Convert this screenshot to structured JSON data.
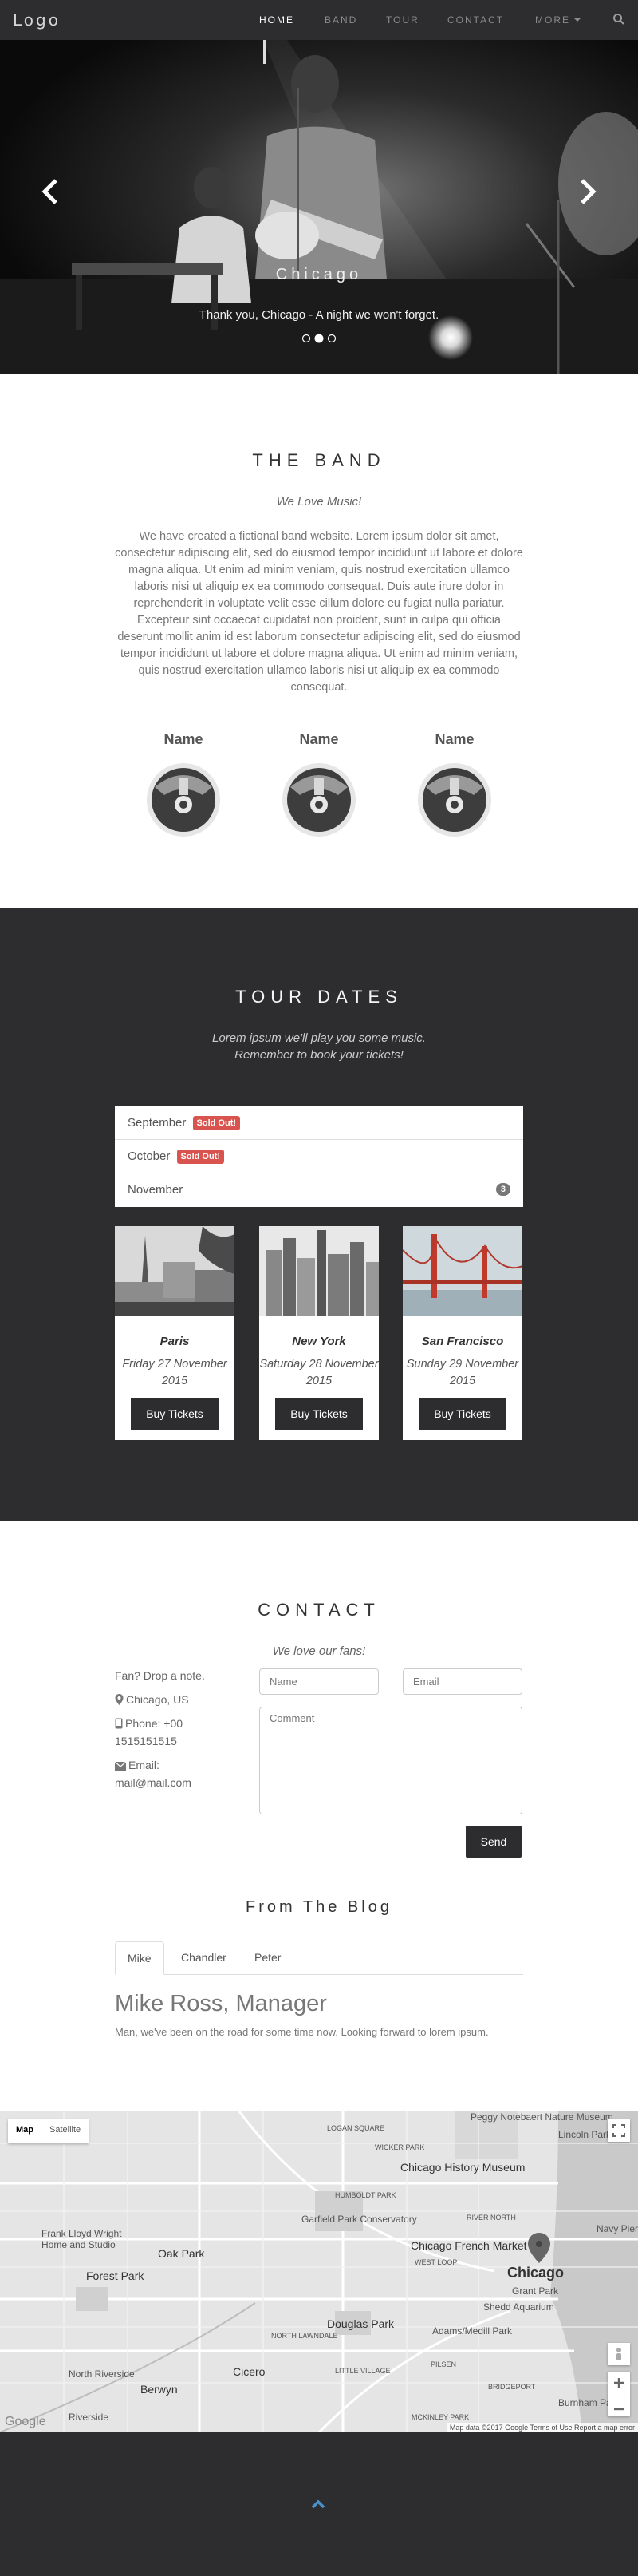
{
  "navbar": {
    "logo": "Logo",
    "items": [
      "HOME",
      "BAND",
      "TOUR",
      "CONTACT",
      "MORE"
    ],
    "active_item": "HOME"
  },
  "hero": {
    "caption_title": "Chicago",
    "caption_text": "Thank you, Chicago - A night we won't forget.",
    "slide_count": 3,
    "active_slide": 2
  },
  "band": {
    "title": "THE BAND",
    "subtitle": "We Love Music!",
    "text": "We have created a fictional band website. Lorem ipsum dolor sit amet, consectetur adipiscing elit, sed do eiusmod tempor incididunt ut labore et dolore magna aliqua. Ut enim ad minim veniam, quis nostrud exercitation ullamco laboris nisi ut aliquip ex ea commodo consequat. Duis aute irure dolor in reprehenderit in voluptate velit esse cillum dolore eu fugiat nulla pariatur. Excepteur sint occaecat cupidatat non proident, sunt in culpa qui officia deserunt mollit anim id est laborum consectetur adipiscing elit, sed do eiusmod tempor incididunt ut labore et dolore magna aliqua. Ut enim ad minim veniam, quis nostrud exercitation ullamco laboris nisi ut aliquip ex ea commodo consequat.",
    "members": [
      "Name",
      "Name",
      "Name"
    ]
  },
  "tour": {
    "title": "TOUR DATES",
    "subtitle_line1": "Lorem ipsum we'll play you some music.",
    "subtitle_line2": "Remember to book your tickets!",
    "months": [
      {
        "name": "September",
        "badge": "Sold Out!"
      },
      {
        "name": "October",
        "badge": "Sold Out!"
      },
      {
        "name": "November",
        "count": "3"
      }
    ],
    "cards": [
      {
        "city": "Paris",
        "date": "Friday 27 November 2015",
        "button": "Buy Tickets"
      },
      {
        "city": "New York",
        "date": "Saturday 28 November 2015",
        "button": "Buy Tickets"
      },
      {
        "city": "San Francisco",
        "date": "Sunday 29 November 2015",
        "button": "Buy Tickets"
      }
    ]
  },
  "contact": {
    "title": "CONTACT",
    "subtitle": "We love our fans!",
    "intro": "Fan? Drop a note.",
    "location": "Chicago, US",
    "phone": "Phone: +00 1515151515",
    "email": "Email: mail@mail.com",
    "name_placeholder": "Name",
    "email_placeholder": "Email",
    "comment_placeholder": "Comment",
    "send_label": "Send"
  },
  "blog": {
    "title": "From The Blog",
    "tabs": [
      "Mike",
      "Chandler",
      "Peter"
    ],
    "active_tab": "Mike",
    "heading": "Mike Ross, Manager",
    "text": "Man, we've been on the road for some time now. Looking forward to lorem ipsum."
  },
  "map": {
    "type_map": "Map",
    "type_satellite": "Satellite",
    "labels": [
      "Peggy Notebaert Nature Museum",
      "Lincoln Park",
      "Chicago History Museum",
      "Garfield Park Conservatory",
      "Chicago French Market",
      "Navy Pier",
      "Frank Lloyd Wright Home and Studio",
      "Oak Park",
      "Forest Park",
      "Chicago",
      "Grant Park",
      "Shedd Aquarium",
      "Douglas Park",
      "Cicero",
      "Berwyn",
      "North Riverside",
      "Riverside",
      "Adams/Medill Park",
      "Burnham Park",
      "HUMBOLDT PARK",
      "WICKER PARK",
      "LOGAN SQUARE",
      "RIVER NORTH",
      "WEST LOOP",
      "LITTLE VILLAGE",
      "PILSEN",
      "NORTH LAWNDALE",
      "MCKINLEY PARK",
      "BRIDGEPORT"
    ],
    "attribution": "Map data ©2017 Google   Terms of Use   Report a map error",
    "google": "Google"
  },
  "colors": {
    "dark": "#2d2d30",
    "sold_out": "#d9534f"
  }
}
